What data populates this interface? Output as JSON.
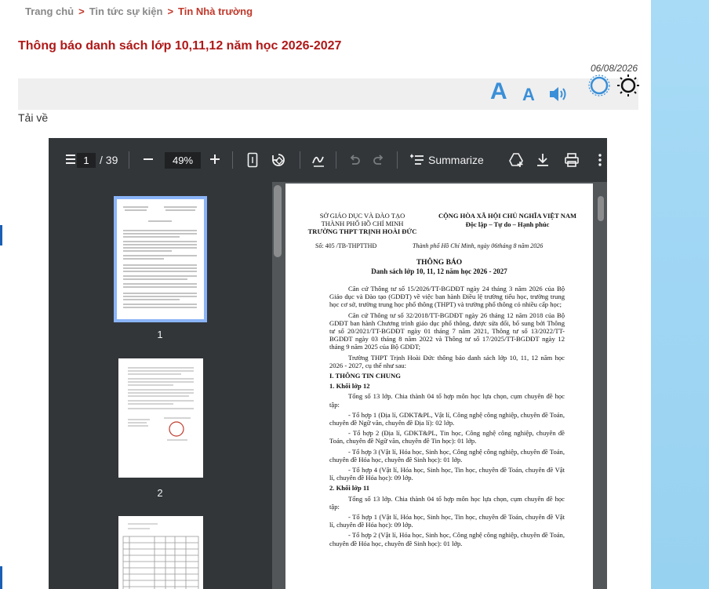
{
  "breadcrumb": {
    "home": "Trang chủ",
    "news": "Tin tức sự kiện",
    "current": "Tin Nhà trường",
    "sep": ">"
  },
  "article": {
    "title": "Thông báo danh sách lớp 10,11,12 năm học 2026-2027",
    "date": "06/08/2026",
    "download_label": "Tải về"
  },
  "tools": {
    "font_increase": "A",
    "font_decrease": "A"
  },
  "pdf_viewer": {
    "page_current": "1",
    "page_total": "/ 39",
    "zoom": "49%",
    "summarize_label": "Summarize",
    "thumbnails": [
      "1",
      "2"
    ]
  },
  "document": {
    "dept_line1": "SỞ GIÁO DỤC VÀ ĐÀO TẠO",
    "dept_line2": "THÀNH PHỐ HỒ CHÍ MINH",
    "school": "TRƯỜNG THPT TRỊNH HOÀI ĐỨC",
    "nation": "CỘNG HÒA XÃ HỘI CHỦ NGHĨA VIỆT NAM",
    "motto": "Độc lập – Tự do – Hạnh phúc",
    "number": "Số: 405   /TB-THPTTHĐ",
    "place_date": "Thành phố Hồ Chí Minh, ngày 06tháng 8  năm 2026",
    "title": "THÔNG BÁO",
    "subtitle": "Danh sách lớp 10, 11, 12 năm học 2026 - 2027",
    "para1": "Căn cứ Thông tư số 15/2026/TT-BGDĐT ngày 24 tháng 3 năm 2026 của Bộ Giáo dục và Đào tạo (GDĐT) về việc ban hành Điều lệ trường tiểu học, trường trung học cơ sở, trường trung học phổ thông (THPT) và trường phổ thông có nhiều cấp học;",
    "para2": "Căn cứ Thông tư số 32/2018/TT-BGDĐT ngày 26 tháng 12 năm 2018 của Bộ GDĐT ban hành Chương trình giáo dục phổ thông, được sửa đổi, bổ sung bởi Thông tư số 20/2021/TT-BGDĐT ngày 01 tháng 7 năm 2021, Thông tư số 13/2022/TT-BGDĐT ngày 03 tháng 8 năm 2022 và Thông tư số 17/2025/TT-BGDĐT ngày 12 tháng 9 năm 2025 của Bộ GDĐT;",
    "para3": "Trường THPT Trịnh Hoài Đức thông báo danh sách lớp 10, 11, 12 năm học 2026 - 2027, cụ thể như sau:",
    "section1": "I. THÔNG TIN CHUNG",
    "grade12": "1. Khối lớp 12",
    "grade12_intro": "Tổng số 13 lớp. Chia thành 04 tổ hợp môn học lựa chọn, cụm chuyên đề học tập:",
    "g12_b1": "- Tổ hợp 1 (Địa lí, GDKT&PL, Vật lí, Công nghệ công nghiệp, chuyên đề Toán, chuyên đề Ngữ văn, chuyên đề Địa lí): 02 lớp.",
    "g12_b2": "- Tổ hợp 2 (Địa lí, GDKT&PL, Tin học, Công nghệ công nghiệp, chuyên đề Toán, chuyên đề Ngữ văn, chuyên đề Tin học): 01 lớp.",
    "g12_b3": "- Tổ hợp 3 (Vật lí, Hóa học, Sinh học, Công nghệ công nghiệp, chuyên đề Toán, chuyên đề Hóa học, chuyên đề Sinh học): 01 lớp.",
    "g12_b4": "- Tổ hợp 4 (Vật lí, Hóa học, Sinh học, Tin học, chuyên đề Toán, chuyên đề Vật lí, chuyên đề Hóa học): 09 lớp.",
    "grade11": "2. Khối lớp 11",
    "grade11_intro": "Tổng số 13 lớp. Chia thành 04 tổ hợp môn học lựa chọn, cụm chuyên đề học tập:",
    "g11_b1": "- Tổ hợp 1 (Vật lí, Hóa học, Sinh học, Tin học, chuyên đề Toán, chuyên đề Vật lí, chuyên đề Hóa học): 09 lớp.",
    "g11_b2": "- Tổ hợp 2 (Vật lí, Hóa học, Sinh học, Công nghệ công nghiệp, chuyên đề Toán, chuyên đề Hóa học, chuyên đề Sinh học): 01 lớp."
  },
  "colors": {
    "accent_red": "#b01818",
    "accent_blue": "#3a8fd8",
    "viewer_bg": "#525659",
    "viewer_toolbar": "#323639"
  }
}
